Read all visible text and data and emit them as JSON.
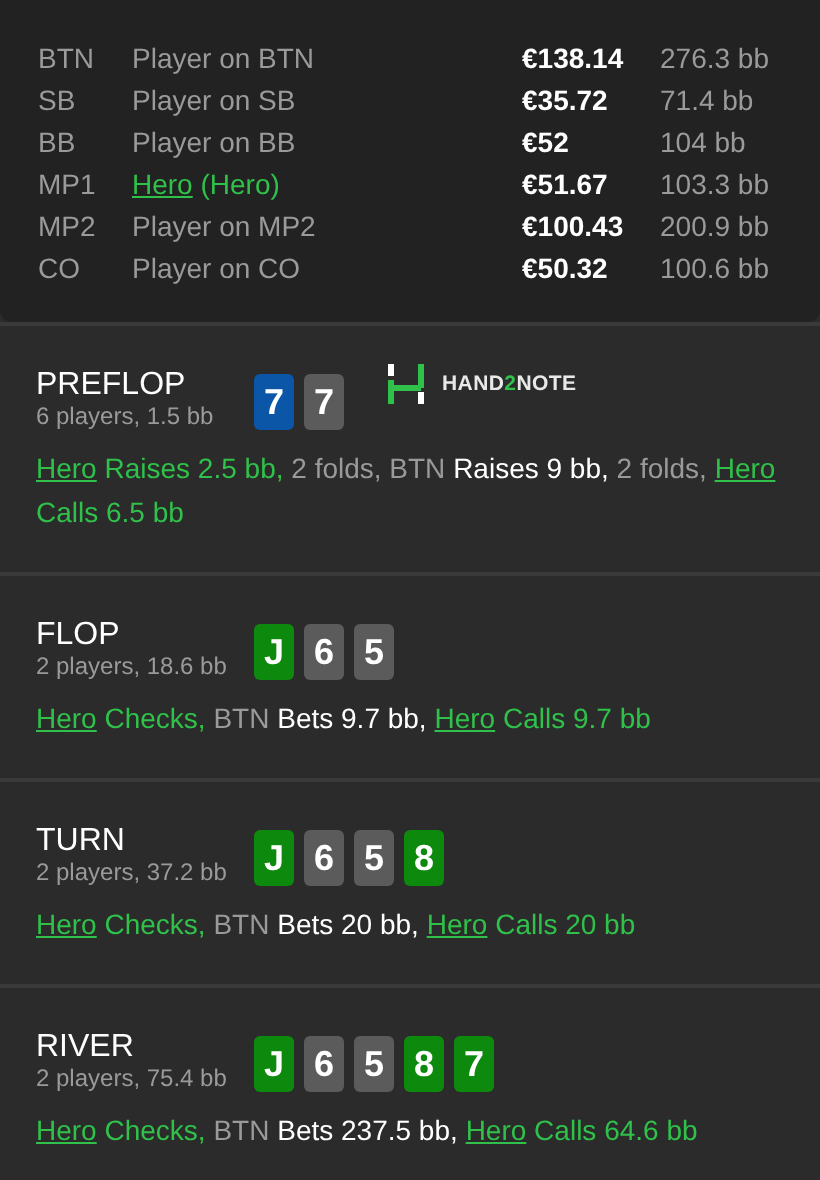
{
  "seats": [
    {
      "position": "BTN",
      "player": "Player on BTN",
      "hero": false,
      "stack": "€138.14",
      "bb": "276.3 bb"
    },
    {
      "position": "SB",
      "player": "Player on SB",
      "hero": false,
      "stack": "€35.72",
      "bb": "71.4 bb"
    },
    {
      "position": "BB",
      "player": "Player on BB",
      "hero": false,
      "stack": "€52",
      "bb": "104 bb"
    },
    {
      "position": "MP1",
      "player": "Hero",
      "hero": true,
      "note": " (Hero)",
      "stack": "€51.67",
      "bb": "103.3 bb"
    },
    {
      "position": "MP2",
      "player": "Player on MP2",
      "hero": false,
      "stack": "€100.43",
      "bb": "200.9 bb"
    },
    {
      "position": "CO",
      "player": "Player on CO",
      "hero": false,
      "stack": "€50.32",
      "bb": "100.6 bb"
    }
  ],
  "streets": [
    {
      "name": "PREFLOP",
      "info": "6 players, 1.5 bb",
      "logo": [
        {
          "kind": "plain",
          "text": "HAND"
        },
        {
          "kind": "accent",
          "text": "2"
        },
        {
          "kind": "plain",
          "text": "NOTE"
        }
      ],
      "cards": [
        {
          "rank": "7",
          "color": "#0b56a6"
        },
        {
          "rank": "7",
          "color": "#5b5b5b"
        }
      ],
      "actions": [
        {
          "kind": "hero-link",
          "text": "Hero"
        },
        {
          "kind": "hero",
          "text": " Raises 2.5 bb,"
        },
        {
          "kind": "other",
          "text": " 2 folds, BTN "
        },
        {
          "kind": "bet",
          "text": "Raises 9 bb,"
        },
        {
          "kind": "other",
          "text": " 2 folds,"
        },
        {
          "kind": "hero-link",
          "text": "Hero"
        },
        {
          "kind": "hero",
          "text": " Calls 6.5 bb"
        }
      ]
    },
    {
      "name": "FLOP",
      "info": "2 players, 18.6 bb",
      "cards": [
        {
          "rank": "J",
          "color": "#0d8a0d"
        },
        {
          "rank": "6",
          "color": "#5b5b5b"
        },
        {
          "rank": "5",
          "color": "#5b5b5b"
        }
      ],
      "actions": [
        {
          "kind": "hero-link",
          "text": "Hero"
        },
        {
          "kind": "hero",
          "text": " Checks,"
        },
        {
          "kind": "other",
          "text": " BTN "
        },
        {
          "kind": "bet",
          "text": "Bets 9.7 bb,"
        },
        {
          "kind": "hero-link",
          "text": "Hero"
        },
        {
          "kind": "hero",
          "text": " Calls 9.7 bb"
        }
      ]
    },
    {
      "name": "TURN",
      "info": "2 players, 37.2 bb",
      "cards": [
        {
          "rank": "J",
          "color": "#0d8a0d"
        },
        {
          "rank": "6",
          "color": "#5b5b5b"
        },
        {
          "rank": "5",
          "color": "#5b5b5b"
        },
        {
          "rank": "8",
          "color": "#0d8a0d"
        }
      ],
      "actions": [
        {
          "kind": "hero-link",
          "text": "Hero"
        },
        {
          "kind": "hero",
          "text": " Checks,"
        },
        {
          "kind": "other",
          "text": " BTN "
        },
        {
          "kind": "bet",
          "text": "Bets 20 bb,"
        },
        {
          "kind": "hero-link",
          "text": "Hero"
        },
        {
          "kind": "hero",
          "text": " Calls 20 bb"
        }
      ]
    },
    {
      "name": "RIVER",
      "info": "2 players, 75.4 bb",
      "cards": [
        {
          "rank": "J",
          "color": "#0d8a0d"
        },
        {
          "rank": "6",
          "color": "#5b5b5b"
        },
        {
          "rank": "5",
          "color": "#5b5b5b"
        },
        {
          "rank": "8",
          "color": "#0d8a0d"
        },
        {
          "rank": "7",
          "color": "#0d8a0d"
        }
      ],
      "actions": [
        {
          "kind": "hero-link",
          "text": "Hero"
        },
        {
          "kind": "hero",
          "text": " Checks,"
        },
        {
          "kind": "other",
          "text": " BTN "
        },
        {
          "kind": "bet",
          "text": "Bets 237.5 bb,"
        },
        {
          "kind": "hero-link",
          "text": "Hero"
        },
        {
          "kind": "hero",
          "text": " Calls 64.6 bb"
        }
      ]
    }
  ]
}
